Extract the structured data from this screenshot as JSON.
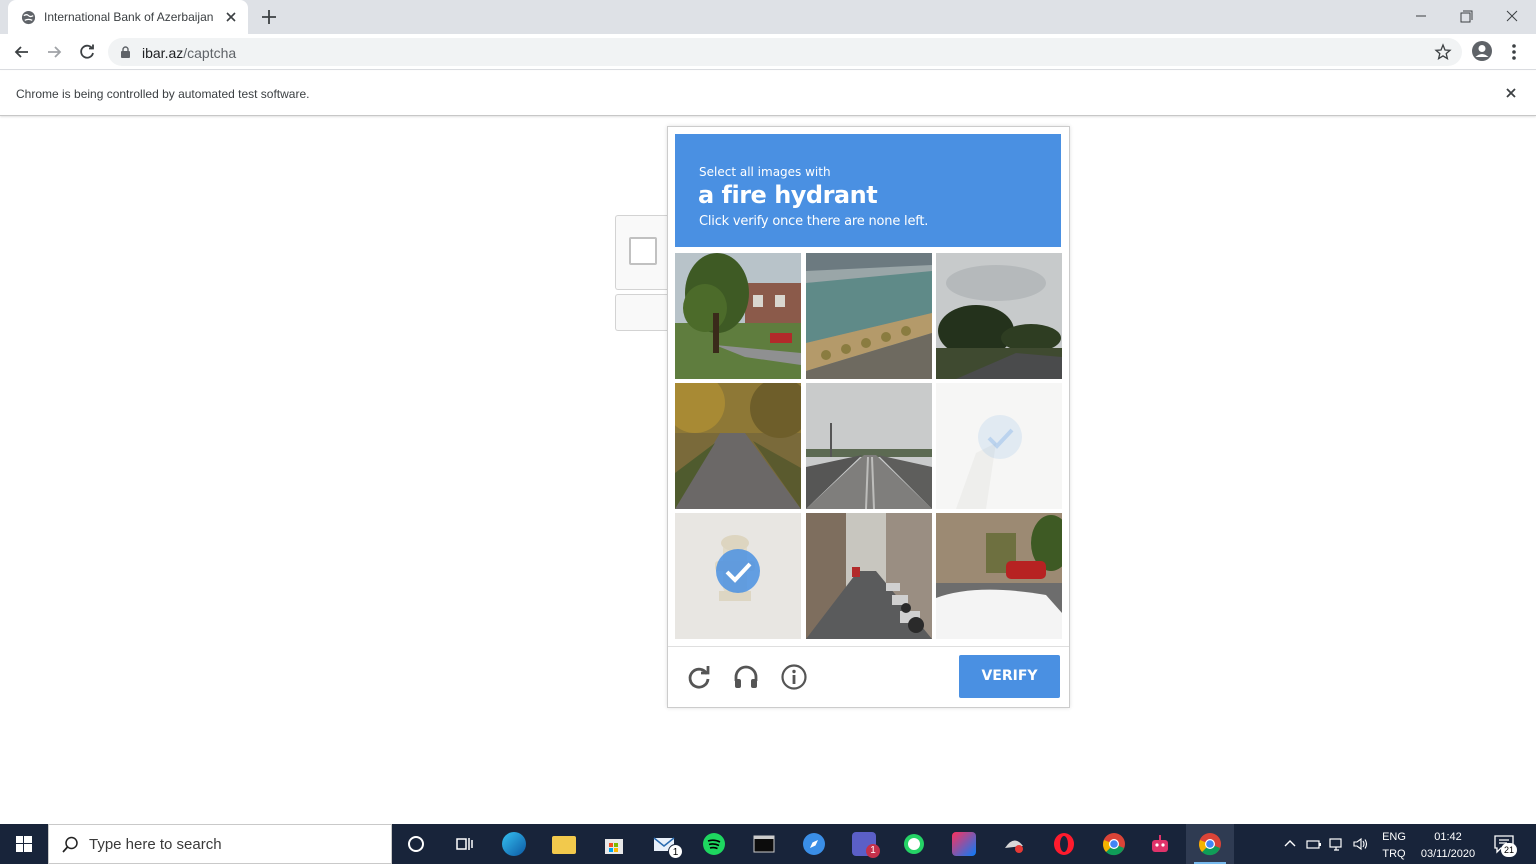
{
  "browser": {
    "tab_title": "International Bank of Azerbaijan",
    "url_host": "ibar.az",
    "url_path": "/captcha",
    "infobar_text": "Chrome is being controlled by automated test software."
  },
  "captcha": {
    "instruction_line1": "Select all images with",
    "instruction_target": "a fire hydrant",
    "instruction_line3": "Click verify once there are none left.",
    "verify_label": "VERIFY",
    "accent_color": "#4a90e2",
    "tiles": [
      {
        "index": 1,
        "scene": "tree-street-houses",
        "selected": false
      },
      {
        "index": 2,
        "scene": "aerial-harbor-boulevard",
        "selected": false
      },
      {
        "index": 3,
        "scene": "road-trees-cloudy",
        "selected": false
      },
      {
        "index": 4,
        "scene": "autumn-residential-road",
        "selected": false
      },
      {
        "index": 5,
        "scene": "highway-bridge",
        "selected": false
      },
      {
        "index": 6,
        "scene": "faded-selected",
        "selected": true
      },
      {
        "index": 7,
        "scene": "fire-hydrant-closeup",
        "selected": true
      },
      {
        "index": 8,
        "scene": "city-street-parked-cars",
        "selected": false
      },
      {
        "index": 9,
        "scene": "warehouse-white-car",
        "selected": false
      }
    ],
    "footer_icons": [
      "reload-icon",
      "headphones-audio-icon",
      "info-icon"
    ]
  },
  "taskbar": {
    "search_placeholder": "Type here to search",
    "lang_line1": "ENG",
    "lang_line2": "TRQ",
    "time": "01:42",
    "date": "03/11/2020",
    "mail_badge": "1",
    "teams_badge": "1",
    "notification_count": "21"
  }
}
